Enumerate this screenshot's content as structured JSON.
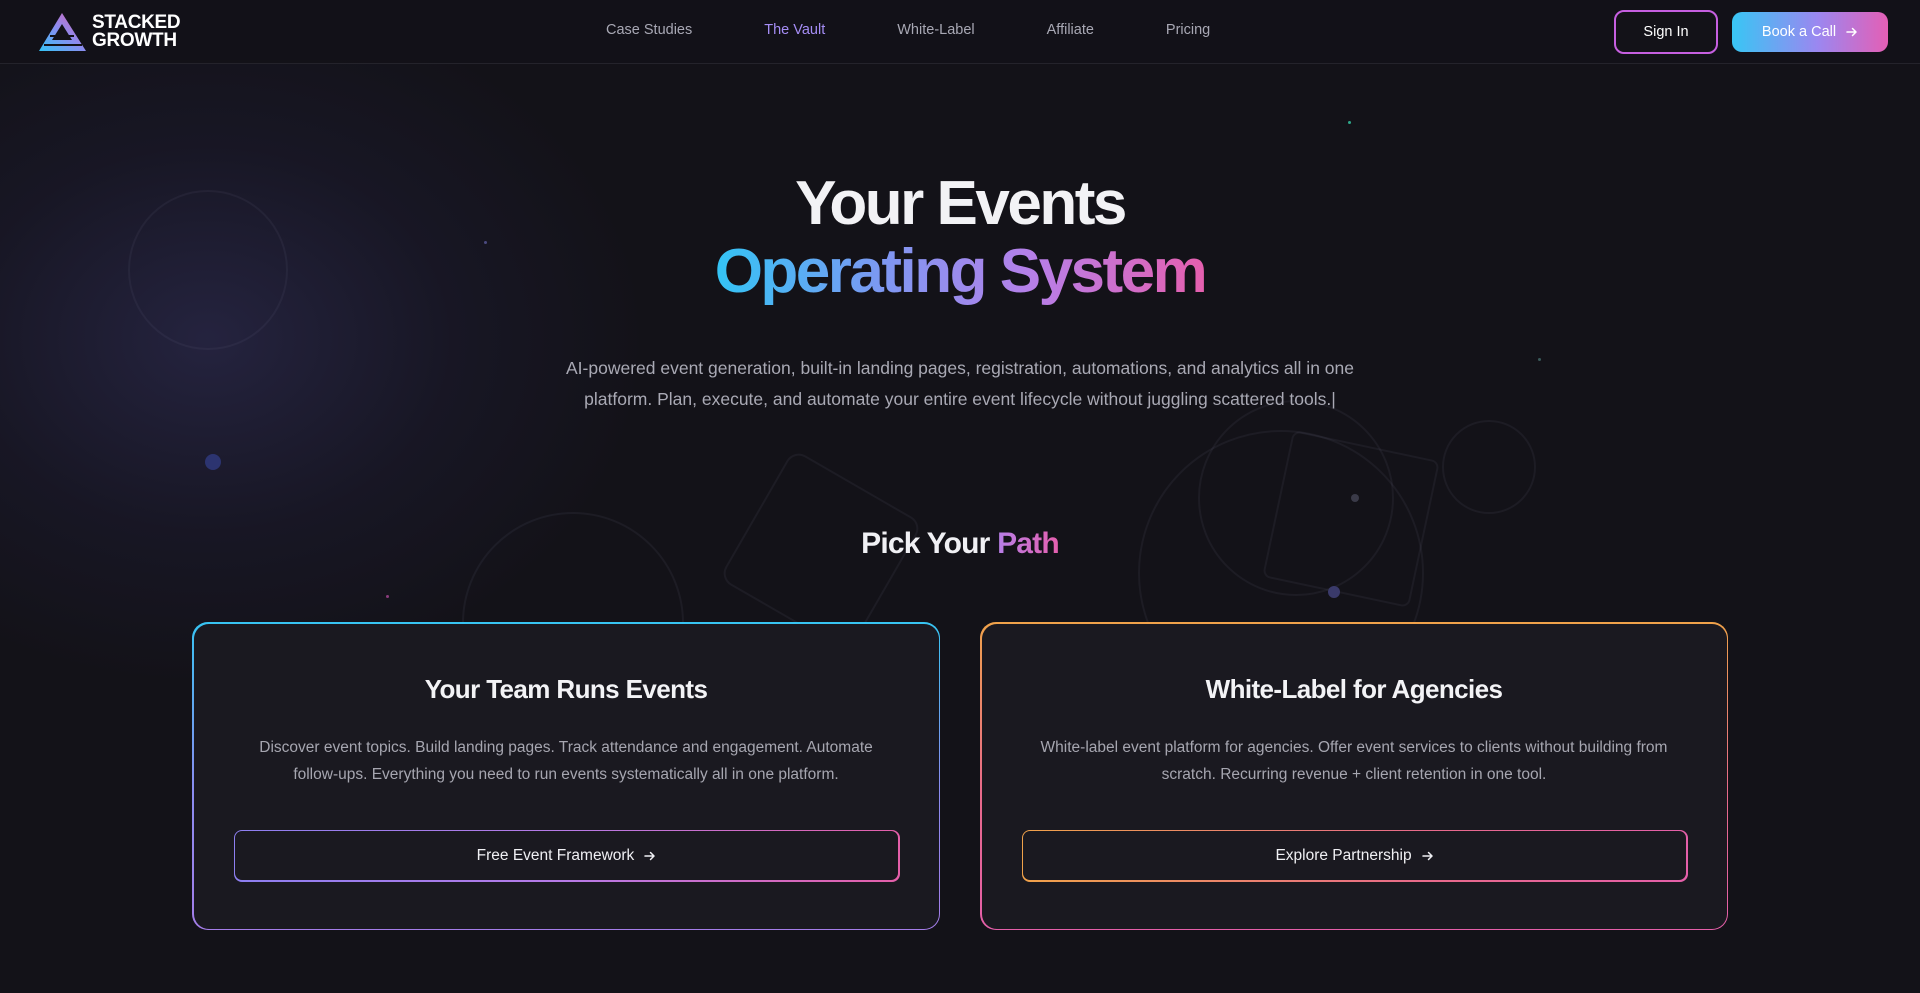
{
  "brand": {
    "logo_line1": "STACKED",
    "logo_line2": "GROWTH",
    "colors": {
      "background": "#131218",
      "accent_cyan": "#33c4f5",
      "accent_purple": "#a58df5",
      "accent_pink": "#e55fae",
      "accent_orange": "#f0a24a"
    }
  },
  "nav": {
    "links": [
      {
        "label": "Case Studies",
        "active": false
      },
      {
        "label": "The Vault",
        "active": true
      },
      {
        "label": "White-Label",
        "active": false
      },
      {
        "label": "Affiliate",
        "active": false
      },
      {
        "label": "Pricing",
        "active": false
      }
    ],
    "sign_in_label": "Sign In",
    "book_call_label": "Book a Call",
    "book_call_icon": "arrow-right-icon"
  },
  "hero": {
    "title_line1": "Your Events",
    "title_line2": "Operating System",
    "subtitle": "AI-powered event generation, built-in landing pages, registration, automations, and analytics all in one platform. Plan, execute, and automate your entire event lifecycle without juggling scattered tools.",
    "cursor": "|"
  },
  "paths": {
    "title_prefix": "Pick Your",
    "title_accent": "Path",
    "cards": [
      {
        "title": "Your Team Runs Events",
        "description": "Discover event topics. Build landing pages. Track attendance and engagement. Automate follow-ups. Everything you need to run events systematically all in one platform.",
        "button_label": "Free Event Framework",
        "button_icon": "arrow-right-icon"
      },
      {
        "title": "White-Label for Agencies",
        "description": "White-label event platform for agencies. Offer event services to clients without building from scratch. Recurring revenue + client retention in one tool.",
        "button_label": "Explore Partnership",
        "button_icon": "arrow-right-icon"
      }
    ]
  }
}
